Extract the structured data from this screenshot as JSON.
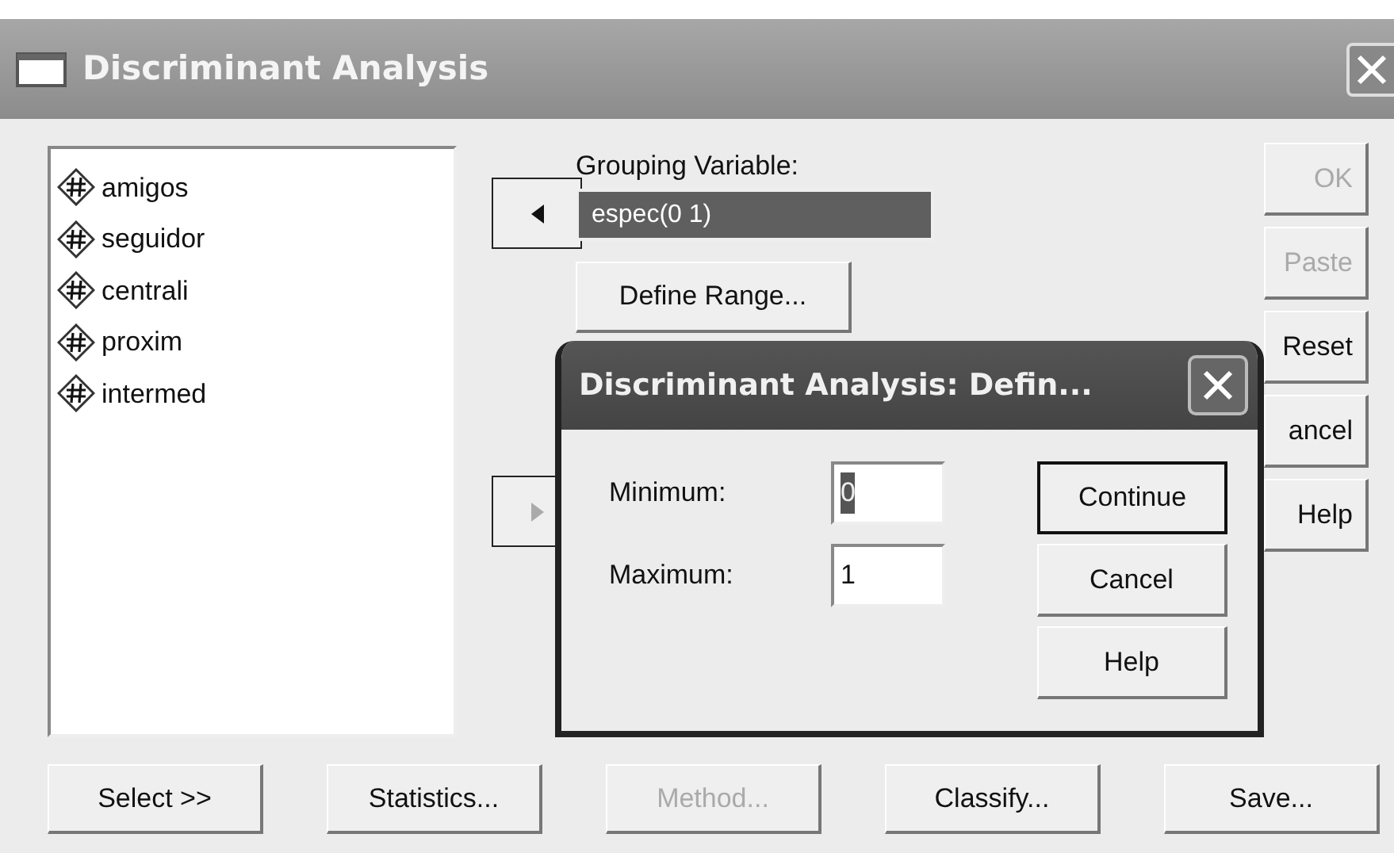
{
  "window": {
    "title": "Discriminant Analysis"
  },
  "variables": [
    {
      "name": "amigos"
    },
    {
      "name": "seguidor"
    },
    {
      "name": "centrali"
    },
    {
      "name": "proxim"
    },
    {
      "name": "intermed"
    }
  ],
  "move_buttons": [
    {
      "kind": "left",
      "disabled": false
    },
    {
      "kind": "right",
      "disabled": true
    }
  ],
  "grouping": {
    "label": "Grouping Variable:",
    "value": "espec(0 1)",
    "selected": true
  },
  "define_range_button": "Define Range...",
  "side_buttons": [
    {
      "label": "OK",
      "disabled": true
    },
    {
      "label": "Paste",
      "disabled": true
    },
    {
      "label": "Reset",
      "disabled": false
    },
    {
      "label": "ancel",
      "disabled": false
    },
    {
      "label": "Help",
      "disabled": false
    }
  ],
  "bottom_buttons": [
    {
      "label": "Select >>",
      "disabled": false
    },
    {
      "label": "Statistics...",
      "disabled": false
    },
    {
      "label": "Method...",
      "disabled": true
    },
    {
      "label": "Classify...",
      "disabled": false
    },
    {
      "label": "Save...",
      "disabled": false
    }
  ],
  "subdialog": {
    "title": "Discriminant Analysis: Defin...",
    "fields": [
      {
        "label": "Minimum:",
        "value": "0",
        "selected": true
      },
      {
        "label": "Maximum:",
        "value": "1",
        "selected": false
      }
    ],
    "buttons": [
      {
        "label": "Continue",
        "default": true
      },
      {
        "label": "Cancel",
        "default": false
      },
      {
        "label": "Help",
        "default": false
      }
    ]
  }
}
